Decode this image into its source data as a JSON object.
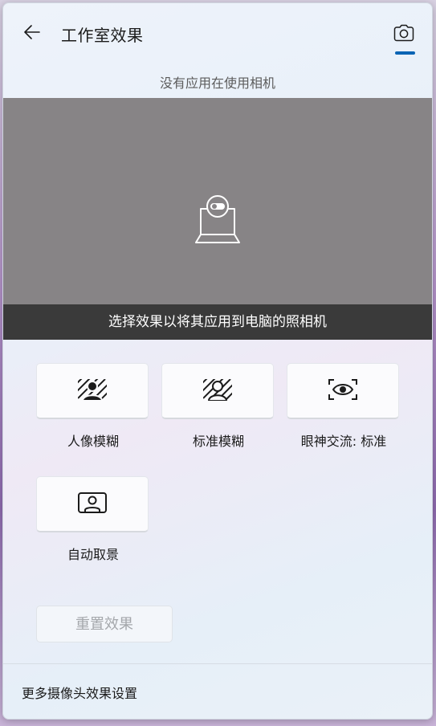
{
  "header": {
    "title": "工作室效果",
    "back_icon": "back-arrow-icon",
    "camera_icon": "camera-icon",
    "accent_color": "#0a64b4"
  },
  "status": {
    "text": "没有应用在使用相机"
  },
  "preview": {
    "icon": "laptop-camera-icon",
    "caption": "选择效果以将其应用到电脑的照相机"
  },
  "effects": [
    {
      "label": "人像模糊",
      "icon": "portrait-blur-icon"
    },
    {
      "label": "标准模糊",
      "icon": "standard-blur-icon"
    },
    {
      "label": "眼神交流: 标准",
      "icon": "eye-contact-icon"
    },
    {
      "label": "自动取景",
      "icon": "auto-framing-icon"
    }
  ],
  "reset_button": {
    "label": "重置效果"
  },
  "footer": {
    "more_settings_link": "更多摄像头效果设置"
  }
}
